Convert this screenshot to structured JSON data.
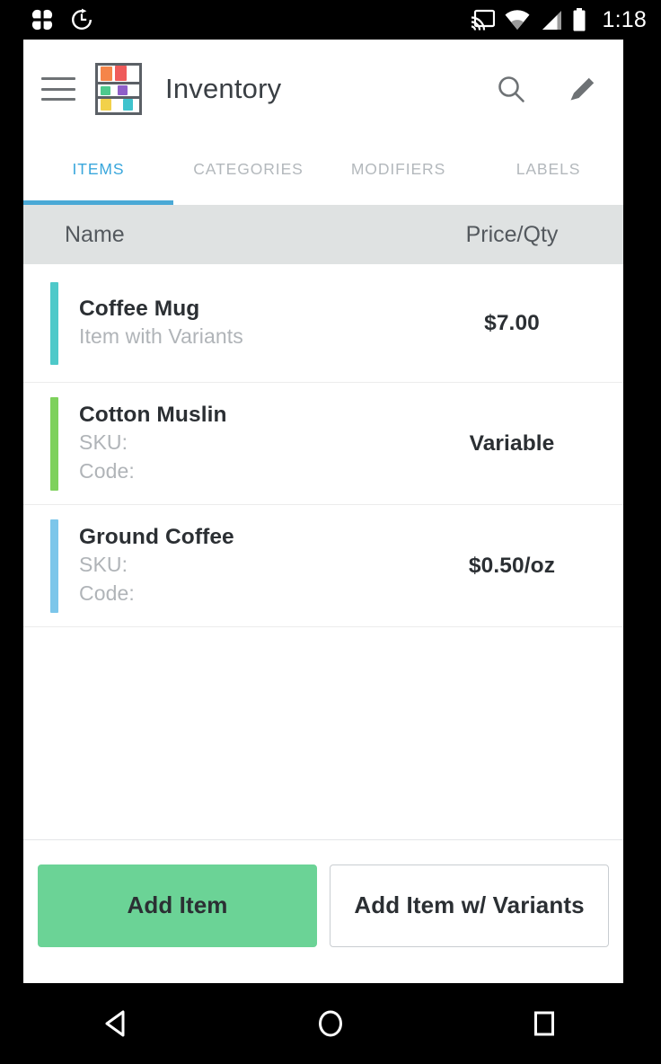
{
  "status_bar": {
    "time": "1:18",
    "left_icons": [
      {
        "name": "clover-app-icon"
      },
      {
        "name": "alarm-history-icon"
      }
    ],
    "right_icons": [
      {
        "name": "cast-icon"
      },
      {
        "name": "wifi-icon"
      },
      {
        "name": "cellular-signal-icon"
      },
      {
        "name": "battery-icon"
      }
    ]
  },
  "appbar": {
    "menu_icon": "hamburger-menu-icon",
    "logo_icon": "inventory-shelf-icon",
    "title": "Inventory",
    "search_icon": "search-icon",
    "edit_icon": "pencil-edit-icon",
    "logo_colors": {
      "frame": "#5b6066",
      "row1": [
        "#f5854a",
        "#ef5b5b"
      ],
      "row2": [
        "#4ec98d",
        "#8e5fc9"
      ],
      "row3": [
        "#f2d14a",
        "#3fc3cd"
      ]
    }
  },
  "tabs": {
    "active_color": "#3aa7dc",
    "inactive_color": "#b3b8bc",
    "items": [
      {
        "label": "ITEMS",
        "active": true
      },
      {
        "label": "CATEGORIES",
        "active": false
      },
      {
        "label": "MODIFIERS",
        "active": false
      },
      {
        "label": "LABELS",
        "active": false
      }
    ]
  },
  "list_header": {
    "name": "Name",
    "price_qty": "Price/Qty"
  },
  "items": [
    {
      "name": "Coffee Mug",
      "lines": [
        "Item with Variants"
      ],
      "price": "$7.00",
      "accent": "#4ec9c9"
    },
    {
      "name": "Cotton Muslin",
      "lines": [
        "SKU:",
        "Code:"
      ],
      "price": "Variable",
      "accent": "#7ed15c"
    },
    {
      "name": "Ground Coffee",
      "lines": [
        "SKU:",
        "Code:"
      ],
      "price": "$0.50/oz",
      "accent": "#7cc6ea"
    }
  ],
  "footer": {
    "add_item_label": "Add Item",
    "add_item_variants_label": "Add Item w/ Variants",
    "primary_color": "#6bd396"
  },
  "navbar": {
    "back_icon": "back-triangle-icon",
    "home_icon": "home-circle-icon",
    "recents_icon": "recents-square-icon"
  }
}
